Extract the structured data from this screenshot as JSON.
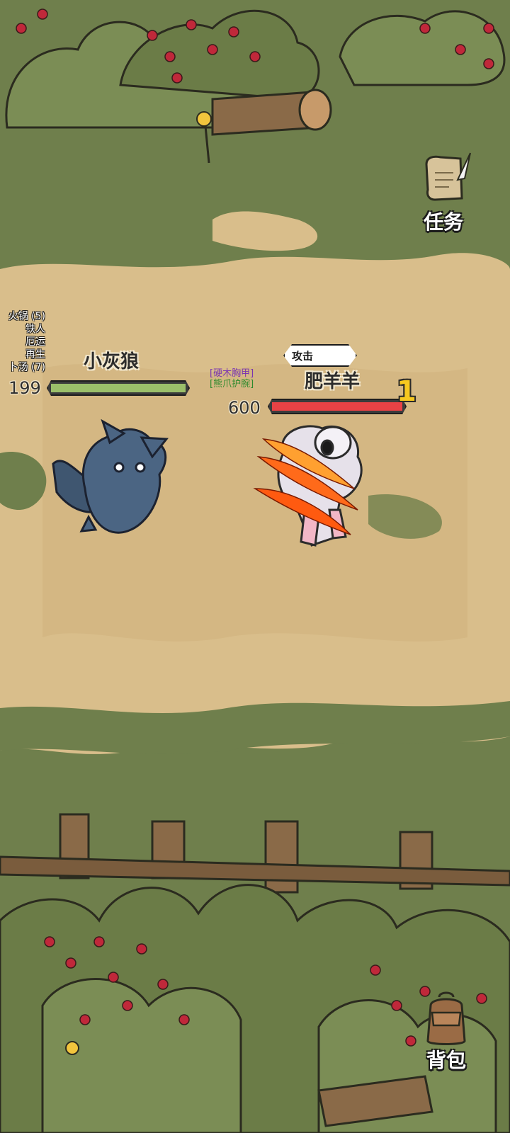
{
  "hud": {
    "quest_label": "任务",
    "bag_label": "背包"
  },
  "status_effects": [
    "火锅 (5)",
    "铁人",
    "厄运",
    "再生",
    "卜汤 (7)"
  ],
  "player": {
    "name": "小灰狼",
    "hp": "199",
    "hp_fraction": 1.0,
    "bar_color": "#9bbf6a"
  },
  "equipment": [
    {
      "label": "[硬木胸甲]",
      "color": "#7a35b0"
    },
    {
      "label": "[熊爪护腕]",
      "color": "#2d8a2d"
    }
  ],
  "enemy": {
    "name": "肥羊羊",
    "hp": "600",
    "hp_fraction": 1.0,
    "level": "1",
    "action": "攻击",
    "bar_color": "#e84245"
  },
  "colors": {
    "grass": "#6f7f4c",
    "dirt": "#d9be8b",
    "berry": "#c0283a"
  }
}
